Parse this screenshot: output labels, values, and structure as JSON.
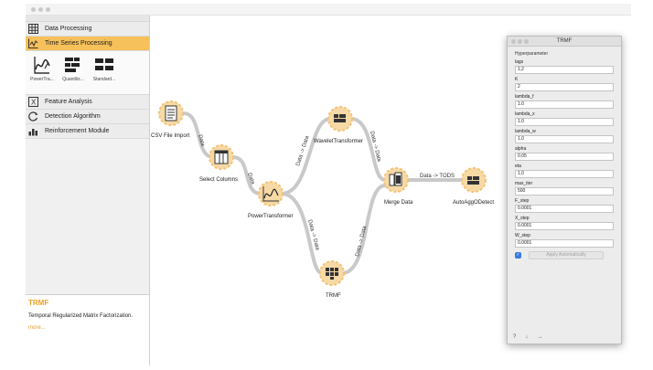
{
  "left_panel": {
    "categories": [
      {
        "label": "Data Processing",
        "icon": "grid-icon"
      },
      {
        "label": "Time Series Processing",
        "icon": "timeseries-icon"
      },
      {
        "label": "Feature Analysis",
        "icon": "feature-icon"
      },
      {
        "label": "Detection Algorithm",
        "icon": "detection-icon"
      },
      {
        "label": "Reinforcement Module",
        "icon": "reinforcement-icon"
      }
    ],
    "widgets": [
      "PowerTra...",
      "Quantiliz...",
      "Standard..."
    ],
    "description": {
      "title": "TRMF",
      "text": "Temporal Regularized Matrix Factorization.",
      "more": "more..."
    }
  },
  "workflow": {
    "nodes": [
      {
        "label": "CSV File Import"
      },
      {
        "label": "Select Columns"
      },
      {
        "label": "PowerTransformer"
      },
      {
        "label": "WaveletTransformer"
      },
      {
        "label": "TRMF"
      },
      {
        "label": "Merge Data"
      },
      {
        "label": "AutoAggODetect"
      }
    ],
    "links": [
      {
        "label": "Data"
      },
      {
        "label": "Data"
      },
      {
        "label": "Data -> Data"
      },
      {
        "label": "Data -> Data"
      },
      {
        "label": "Data -> Data"
      },
      {
        "label": "Data -> Data"
      },
      {
        "label": "Data -> TODS"
      }
    ]
  },
  "popup": {
    "title": "TRMF",
    "section": "Hyperparameter",
    "fields": [
      {
        "label": "lags",
        "value": "1,2"
      },
      {
        "label": "K",
        "value": "2"
      },
      {
        "label": "lambda_f",
        "value": "1.0"
      },
      {
        "label": "lambda_x",
        "value": "1.0"
      },
      {
        "label": "lambda_w",
        "value": "1.0"
      },
      {
        "label": "alpha",
        "value": "0.05"
      },
      {
        "label": "eta",
        "value": "1.0"
      },
      {
        "label": "max_iter",
        "value": "500"
      },
      {
        "label": "F_step",
        "value": "0.0001"
      },
      {
        "label": "X_step",
        "value": "0.0001"
      },
      {
        "label": "W_step",
        "value": "0.0001"
      }
    ],
    "apply_checked": "✓",
    "apply_label": "Apply Automatically",
    "footer": [
      "?",
      "↓",
      "→"
    ]
  },
  "colors": {
    "accent": "#f6c05a",
    "node_fill": "#f7d9a6",
    "node_border": "#f3c375",
    "link": "#c9c9c9",
    "description_title": "#f0a020"
  }
}
